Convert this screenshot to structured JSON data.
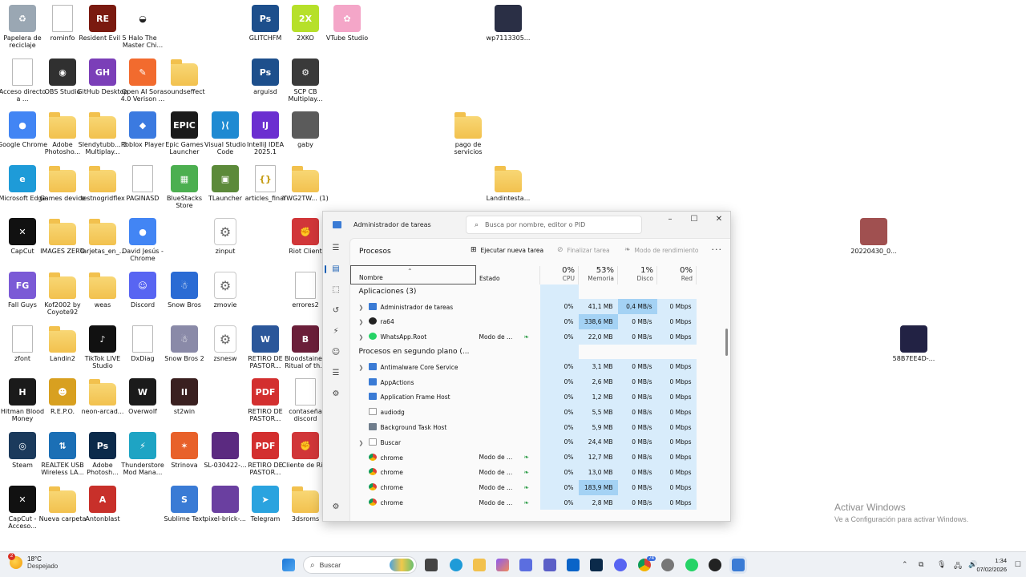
{
  "desktop": {
    "icons": [
      {
        "label": "Papelera de reciclaje",
        "kind": "recycle-bin-icon",
        "bg": "#9aa7b3",
        "glyph": "♻"
      },
      {
        "label": "rominfo",
        "kind": "file-icon",
        "bg": "",
        "glyph": ""
      },
      {
        "label": "Resident Evil 5",
        "kind": "resident-evil-icon",
        "bg": "#7a1a10",
        "glyph": "RE"
      },
      {
        "label": "Halo The Master Chi...",
        "kind": "halo-icon",
        "bg": "#ffffff",
        "glyph": "◒"
      },
      {
        "label": "GLITCHFM",
        "kind": "photoshop-file-icon",
        "bg": "#1d4f8c",
        "glyph": "Ps"
      },
      {
        "label": "2XKO",
        "kind": "2xko-icon",
        "bg": "#b6e02a",
        "glyph": "2X"
      },
      {
        "label": "VTube Studio",
        "kind": "vtube-studio-icon",
        "bg": "#f4a6c8",
        "glyph": "✿"
      },
      {
        "label": "wp7113305...",
        "kind": "image-file-icon",
        "bg": "#2a2f45",
        "glyph": ""
      },
      {
        "label": "Acceso directo a ...",
        "kind": "shortcut-file-icon",
        "bg": "",
        "glyph": ""
      },
      {
        "label": "OBS Studio",
        "kind": "obs-icon",
        "bg": "#303030",
        "glyph": "◉"
      },
      {
        "label": "GitHub Desktop",
        "kind": "github-icon",
        "bg": "#7b3fb8",
        "glyph": "GH"
      },
      {
        "label": "Open AI Sora 4.0 Verison ...",
        "kind": "sora-icon",
        "bg": "#f26b2e",
        "glyph": "✎"
      },
      {
        "label": "soundseffect",
        "kind": "folder-icon",
        "bg": "",
        "glyph": ""
      },
      {
        "label": "arguisd",
        "kind": "photoshop-file-icon",
        "bg": "#1d4f8c",
        "glyph": "Ps"
      },
      {
        "label": "SCP CB Multiplay...",
        "kind": "scp-icon",
        "bg": "#3a3a3a",
        "glyph": "⚙"
      },
      {
        "label": "Google Chrome",
        "kind": "chrome-icon",
        "bg": "#4285f4",
        "glyph": "●"
      },
      {
        "label": "Adobe Photosho...",
        "kind": "folder-icon",
        "bg": "",
        "glyph": ""
      },
      {
        "label": "Slendytubb... 3 Multiplay...",
        "kind": "folder-icon",
        "bg": "",
        "glyph": ""
      },
      {
        "label": "Roblox Player",
        "kind": "roblox-icon",
        "bg": "#3b7ae0",
        "glyph": "◆"
      },
      {
        "label": "Epic Games Launcher",
        "kind": "epic-games-icon",
        "bg": "#1b1b1b",
        "glyph": "EPIC"
      },
      {
        "label": "Visual Studio Code",
        "kind": "vscode-icon",
        "bg": "#1f8ad2",
        "glyph": "⟩⟨"
      },
      {
        "label": "IntelliJ IDEA 2025.1",
        "kind": "intellij-icon",
        "bg": "#6b2fd0",
        "glyph": "IJ"
      },
      {
        "label": "gaby",
        "kind": "image-file-icon",
        "bg": "#5b5b5b",
        "glyph": ""
      },
      {
        "label": "pago de servicios",
        "kind": "folder-icon",
        "bg": "",
        "glyph": ""
      },
      {
        "label": "Microsoft Edge",
        "kind": "edge-icon",
        "bg": "#1e9bd8",
        "glyph": "e"
      },
      {
        "label": "Games device",
        "kind": "folder-icon",
        "bg": "",
        "glyph": ""
      },
      {
        "label": "testnogridflex",
        "kind": "folder-icon",
        "bg": "",
        "glyph": ""
      },
      {
        "label": "PAGINASD",
        "kind": "file-icon",
        "bg": "",
        "glyph": ""
      },
      {
        "label": "BlueStacks Store",
        "kind": "bluestacks-icon",
        "bg": "#4caf50",
        "glyph": "▦"
      },
      {
        "label": "TLauncher",
        "kind": "tlauncher-icon",
        "bg": "#5c8a3a",
        "glyph": "▣"
      },
      {
        "label": "articles_final",
        "kind": "json-file-icon",
        "bg": "",
        "glyph": "{}"
      },
      {
        "label": "YWG2TW... (1)",
        "kind": "zip-folder-icon",
        "bg": "",
        "glyph": ""
      },
      {
        "label": "Landintesta...",
        "kind": "folder-icon",
        "bg": "",
        "glyph": ""
      },
      {
        "label": "CapCut",
        "kind": "capcut-icon",
        "bg": "#111111",
        "glyph": "✕"
      },
      {
        "label": "IMAGES ZERO",
        "kind": "folder-icon",
        "bg": "",
        "glyph": ""
      },
      {
        "label": "Tarjetas_en_...",
        "kind": "folder-icon",
        "bg": "",
        "glyph": ""
      },
      {
        "label": "David Jesús - Chrome",
        "kind": "chrome-icon",
        "bg": "#4285f4",
        "glyph": "●"
      },
      {
        "label": "zinput",
        "kind": "settings-file-icon",
        "bg": "",
        "glyph": "⚙"
      },
      {
        "label": "Riot Client",
        "kind": "riot-icon",
        "bg": "#d13639",
        "glyph": "✊"
      },
      {
        "label": "20220430_0...",
        "kind": "image-file-icon",
        "bg": "#a05050",
        "glyph": ""
      },
      {
        "label": "Fall Guys",
        "kind": "fall-guys-icon",
        "bg": "#7b5ad6",
        "glyph": "FG"
      },
      {
        "label": "Kof2002 by Coyote92",
        "kind": "folder-icon",
        "bg": "",
        "glyph": ""
      },
      {
        "label": "weas",
        "kind": "folder-icon",
        "bg": "",
        "glyph": ""
      },
      {
        "label": "Discord",
        "kind": "discord-icon",
        "bg": "#5865f2",
        "glyph": "☺"
      },
      {
        "label": "Snow Bros",
        "kind": "snow-bros-icon",
        "bg": "#2a6bd4",
        "glyph": "☃"
      },
      {
        "label": "zmovie",
        "kind": "settings-file-icon",
        "bg": "",
        "glyph": "⚙"
      },
      {
        "label": "errores2",
        "kind": "file-icon",
        "bg": "",
        "glyph": ""
      },
      {
        "label": "zfont",
        "kind": "file-icon",
        "bg": "",
        "glyph": ""
      },
      {
        "label": "Landin2",
        "kind": "folder-icon",
        "bg": "",
        "glyph": ""
      },
      {
        "label": "TikTok LIVE Studio",
        "kind": "tiktok-icon",
        "bg": "#111111",
        "glyph": "♪"
      },
      {
        "label": "DxDiag",
        "kind": "file-icon",
        "bg": "",
        "glyph": ""
      },
      {
        "label": "Snow Bros 2",
        "kind": "snow-bros-2-icon",
        "bg": "#8a8aa8",
        "glyph": "☃"
      },
      {
        "label": "zsnesw",
        "kind": "settings-file-icon",
        "bg": "",
        "glyph": "⚙"
      },
      {
        "label": "RETIRO DE PASTOR...",
        "kind": "word-file-icon",
        "bg": "#2b579a",
        "glyph": "W"
      },
      {
        "label": "Bloodstained Ritual of th...",
        "kind": "bloodstained-icon",
        "bg": "#6b1f3a",
        "glyph": "B"
      },
      {
        "label": "58B7EE4D-...",
        "kind": "image-file-icon",
        "bg": "#222244",
        "glyph": ""
      },
      {
        "label": "Hitman Blood Money",
        "kind": "hitman-icon",
        "bg": "#1a1a1a",
        "glyph": "H"
      },
      {
        "label": "R.E.P.O.",
        "kind": "repo-icon",
        "bg": "#d8a020",
        "glyph": "☻"
      },
      {
        "label": "neon-arcad...",
        "kind": "zip-folder-icon",
        "bg": "",
        "glyph": ""
      },
      {
        "label": "Overwolf",
        "kind": "overwolf-icon",
        "bg": "#1b1b1b",
        "glyph": "W"
      },
      {
        "label": "st2win",
        "kind": "street-fighter-icon",
        "bg": "#3a2020",
        "glyph": "II"
      },
      {
        "label": "RETIRO DE PASTOR...",
        "kind": "pdf-file-icon",
        "bg": "#d32f2f",
        "glyph": "PDF"
      },
      {
        "label": "contaseña discord",
        "kind": "file-icon",
        "bg": "",
        "glyph": ""
      },
      {
        "label": "Steam",
        "kind": "steam-icon",
        "bg": "#1b3a5c",
        "glyph": "◎"
      },
      {
        "label": "REALTEK USB Wireless LA...",
        "kind": "realtek-icon",
        "bg": "#1b6fb5",
        "glyph": "⇅"
      },
      {
        "label": "Adobe Photosh...",
        "kind": "photoshop-icon",
        "bg": "#0b2a4a",
        "glyph": "Ps"
      },
      {
        "label": "Thunderstore Mod Mana...",
        "kind": "thunderstore-icon",
        "bg": "#1ea4c4",
        "glyph": "⚡"
      },
      {
        "label": "Strinova",
        "kind": "strinova-icon",
        "bg": "#e8612a",
        "glyph": "✶"
      },
      {
        "label": "SL-030422-...",
        "kind": "image-file-icon",
        "bg": "#5b2a80",
        "glyph": ""
      },
      {
        "label": "RETIRO DE PASTOR...",
        "kind": "pdf-file-icon",
        "bg": "#d32f2f",
        "glyph": "PDF"
      },
      {
        "label": "Cliente de Riot",
        "kind": "riot-icon",
        "bg": "#d13639",
        "glyph": "✊"
      },
      {
        "label": "CapCut - Acceso...",
        "kind": "capcut-icon",
        "bg": "#111111",
        "glyph": "✕"
      },
      {
        "label": "Nueva carpeta",
        "kind": "folder-icon",
        "bg": "",
        "glyph": ""
      },
      {
        "label": "Antonblast",
        "kind": "antonblast-icon",
        "bg": "#c8302a",
        "glyph": "A"
      },
      {
        "label": "Sublime Text",
        "kind": "sublime-file-icon",
        "bg": "#3a7bd5",
        "glyph": "S"
      },
      {
        "label": "pixel-brick-...",
        "kind": "image-file-icon",
        "bg": "#6a3fa0",
        "glyph": ""
      },
      {
        "label": "Telegram",
        "kind": "telegram-icon",
        "bg": "#2aa3df",
        "glyph": "➤"
      },
      {
        "label": "3dsroms",
        "kind": "folder-icon",
        "bg": "",
        "glyph": ""
      }
    ]
  },
  "taskmanager": {
    "title": "Administrador de tareas",
    "search_placeholder": "Busca por nombre, editor o PID",
    "page_title": "Procesos",
    "toolbar": {
      "run_task": "Ejecutar nueva tarea",
      "end_task": "Finalizar tarea",
      "efficiency": "Modo de rendimiento"
    },
    "columns": {
      "name": "Nombre",
      "status": "Estado",
      "cpu_pct": "0%",
      "cpu": "CPU",
      "mem_pct": "53%",
      "mem": "Memoria",
      "disk_pct": "1%",
      "disk": "Disco",
      "net_pct": "0%",
      "net": "Red"
    },
    "groups": [
      {
        "label": "Aplicaciones (3)",
        "rows": [
          {
            "name": "Administrador de tareas",
            "status": "",
            "efficiency": false,
            "cpu": "0%",
            "mem": "41,1 MB",
            "disk": "0,4 MB/s",
            "net": "0 Mbps",
            "expand": true,
            "icon": "blue",
            "mem_heat": "heat1",
            "disk_heat": "heat3"
          },
          {
            "name": "ra64",
            "status": "",
            "efficiency": false,
            "cpu": "0%",
            "mem": "338,6 MB",
            "disk": "0 MB/s",
            "net": "0 Mbps",
            "expand": true,
            "icon": "black",
            "mem_heat": "heat3",
            "disk_heat": "heat1"
          },
          {
            "name": "WhatsApp.Root",
            "status": "Modo de ...",
            "efficiency": true,
            "cpu": "0%",
            "mem": "22,0 MB",
            "disk": "0 MB/s",
            "net": "0 Mbps",
            "expand": true,
            "icon": "green",
            "mem_heat": "heat1",
            "disk_heat": "heat1"
          }
        ]
      },
      {
        "label": "Procesos en segundo plano (...",
        "rows": [
          {
            "name": "Antimalware Core Service",
            "status": "",
            "efficiency": false,
            "cpu": "0%",
            "mem": "3,1 MB",
            "disk": "0 MB/s",
            "net": "0 Mbps",
            "expand": true,
            "icon": "blue",
            "mem_heat": "heat1",
            "disk_heat": "heat1"
          },
          {
            "name": "AppActions",
            "status": "",
            "efficiency": false,
            "cpu": "0%",
            "mem": "2,6 MB",
            "disk": "0 MB/s",
            "net": "0 Mbps",
            "expand": false,
            "icon": "blue",
            "mem_heat": "heat1",
            "disk_heat": "heat1"
          },
          {
            "name": "Application Frame Host",
            "status": "",
            "efficiency": false,
            "cpu": "0%",
            "mem": "1,2 MB",
            "disk": "0 MB/s",
            "net": "0 Mbps",
            "expand": false,
            "icon": "blue",
            "mem_heat": "heat1",
            "disk_heat": "heat1"
          },
          {
            "name": "audiodg",
            "status": "",
            "efficiency": false,
            "cpu": "0%",
            "mem": "5,5 MB",
            "disk": "0 MB/s",
            "net": "0 Mbps",
            "expand": false,
            "icon": "box",
            "mem_heat": "heat1",
            "disk_heat": "heat1"
          },
          {
            "name": "Background Task Host",
            "status": "",
            "efficiency": false,
            "cpu": "0%",
            "mem": "5,9 MB",
            "disk": "0 MB/s",
            "net": "0 Mbps",
            "expand": false,
            "icon": "grey",
            "mem_heat": "heat1",
            "disk_heat": "heat1"
          },
          {
            "name": "Buscar",
            "status": "",
            "efficiency": false,
            "cpu": "0%",
            "mem": "24,4 MB",
            "disk": "0 MB/s",
            "net": "0 Mbps",
            "expand": true,
            "icon": "box",
            "mem_heat": "heat1",
            "disk_heat": "heat1"
          },
          {
            "name": "chrome",
            "status": "Modo de ...",
            "efficiency": true,
            "cpu": "0%",
            "mem": "12,7 MB",
            "disk": "0 MB/s",
            "net": "0 Mbps",
            "expand": false,
            "icon": "chrome",
            "mem_heat": "heat1",
            "disk_heat": "heat1"
          },
          {
            "name": "chrome",
            "status": "Modo de ...",
            "efficiency": true,
            "cpu": "0%",
            "mem": "13,0 MB",
            "disk": "0 MB/s",
            "net": "0 Mbps",
            "expand": false,
            "icon": "chrome",
            "mem_heat": "heat1",
            "disk_heat": "heat1"
          },
          {
            "name": "chrome",
            "status": "Modo de ...",
            "efficiency": true,
            "cpu": "0%",
            "mem": "183,9 MB",
            "disk": "0 MB/s",
            "net": "0 Mbps",
            "expand": false,
            "icon": "chrome",
            "mem_heat": "heat3",
            "disk_heat": "heat1"
          },
          {
            "name": "chrome",
            "status": "Modo de ...",
            "efficiency": true,
            "cpu": "0%",
            "mem": "2,8 MB",
            "disk": "0 MB/s",
            "net": "0 Mbps",
            "expand": false,
            "icon": "chrome",
            "mem_heat": "heat1",
            "disk_heat": "heat1"
          }
        ]
      }
    ]
  },
  "activation": {
    "title": "Activar Windows",
    "subtitle": "Ve a Configuración para activar Windows."
  },
  "taskbar": {
    "weather_temp": "18°C",
    "weather_desc": "Despejado",
    "weather_badge": "2",
    "search_placeholder": "Buscar",
    "badge_count": "74",
    "time": "1:34",
    "date": "07/02/2026"
  }
}
